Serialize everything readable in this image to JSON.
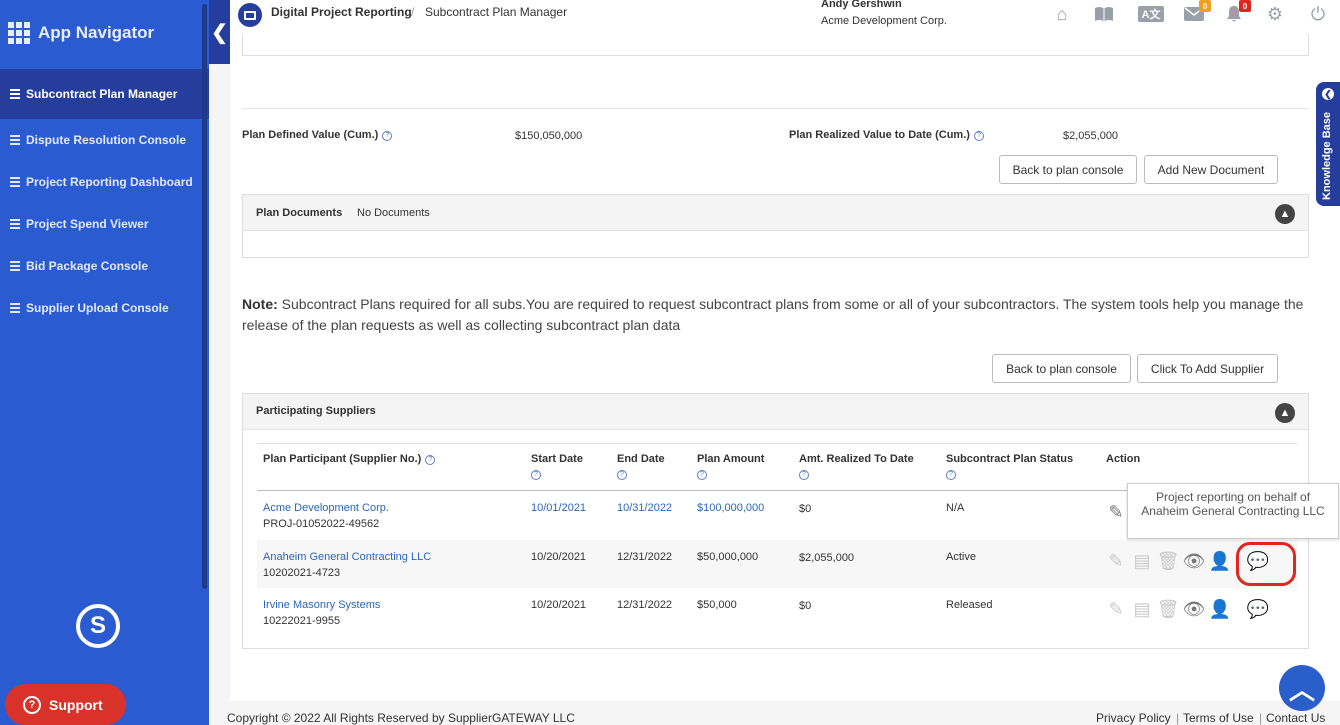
{
  "sidebar": {
    "title": "App Navigator",
    "items": [
      {
        "label": "Subcontract Plan Manager",
        "active": true
      },
      {
        "label": "Dispute Resolution Console"
      },
      {
        "label": "Project Reporting Dashboard"
      },
      {
        "label": "Project Spend Viewer"
      },
      {
        "label": "Bid Package Console"
      },
      {
        "label": "Supplier Upload Console"
      }
    ],
    "logo_letter": "S",
    "support_label": "Support"
  },
  "header": {
    "breadcrumb": [
      "Digital Project Reporting",
      "Subcontract Plan Manager"
    ],
    "breadcrumb_sep": "/",
    "user_name": "Andy Gershwin",
    "user_org": "Acme Development Corp.",
    "icons": [
      "home-icon",
      "book-icon",
      "translate-icon",
      "mail-icon",
      "bell-icon",
      "settings-icon",
      "power-icon"
    ],
    "mail_badge": "0",
    "bell_badge": "0",
    "translate_text": "A文"
  },
  "knowledge_base": "Knowledge Base",
  "plan": {
    "defined_label": "Plan Defined Value (Cum.)",
    "defined_value": "$150,050,000",
    "realized_label": "Plan Realized Value to Date (Cum.)",
    "realized_value": "$2,055,000",
    "back_button": "Back to plan console",
    "add_document_button": "Add New Document"
  },
  "documents": {
    "title": "Plan Documents",
    "status": "No Documents"
  },
  "note": {
    "prefix": "Note:",
    "text": " Subcontract Plans required for all subs.You are required to request subcontract plans from some or all of your subcontractors. The system tools help you manage the release of the plan requests as well as collecting subcontract plan data"
  },
  "suppliers": {
    "back_button": "Back to plan console",
    "add_supplier_button": "Click To Add Supplier",
    "title": "Participating Suppliers",
    "columns": [
      "Plan Participant (Supplier No.)",
      "Start Date",
      "End Date",
      "Plan Amount",
      "Amt. Realized To Date",
      "Subcontract Plan Status",
      "Action"
    ],
    "rows": [
      {
        "name": "Acme Development Corp.",
        "number": "PROJ-01052022-49562",
        "start": "10/01/2021",
        "end": "10/31/2022",
        "amount": "$100,000,000",
        "realized": "$0",
        "status": "N/A"
      },
      {
        "name": "Anaheim General Contracting LLC",
        "number": "10202021-4723",
        "start": "10/20/2021",
        "end": "12/31/2022",
        "amount": "$50,000,000",
        "realized": "$2,055,000",
        "status": "Active"
      },
      {
        "name": "Irvine Masonry Systems",
        "number": "10222021-9955",
        "start": "10/20/2021",
        "end": "12/31/2022",
        "amount": "$50,000",
        "realized": "$0",
        "status": "Released"
      }
    ]
  },
  "tooltip": "Project reporting on behalf of Anaheim General Contracting LLC",
  "footer": {
    "copyright": "Copyright © 2022 All Rights Reserved by SupplierGATEWAY LLC",
    "links": [
      "Privacy Policy",
      "Terms of Use",
      "Contact Us"
    ],
    "sep": "|"
  },
  "colors": {
    "sidebar": "#2b5bd0",
    "sidebar_active": "#253e9e",
    "link": "#2a67b8",
    "highlight": "#e0261f",
    "support": "#d9322b"
  }
}
